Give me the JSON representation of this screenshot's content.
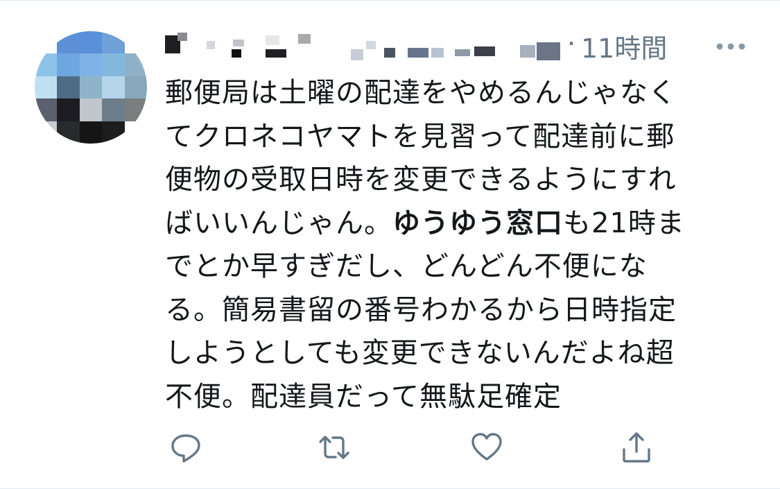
{
  "tweet": {
    "time": "11時間",
    "separator": "·",
    "body_lines": [
      {
        "parts": [
          {
            "text": "郵便局は土曜の配達をやめるんじゃなく",
            "bold": false
          }
        ]
      },
      {
        "parts": [
          {
            "text": "てクロネコヤマトを見習って配達前に郵",
            "bold": false
          }
        ]
      },
      {
        "parts": [
          {
            "text": "便物の受取日時を変更できるようにすれ",
            "bold": false
          }
        ]
      },
      {
        "parts": [
          {
            "text": "ばいいんじゃん。",
            "bold": false
          },
          {
            "text": "ゆうゆう窓口",
            "bold": true
          },
          {
            "text": "も21時ま",
            "bold": false
          }
        ]
      },
      {
        "parts": [
          {
            "text": "でとか早すぎだし、どんどん不便にな",
            "bold": false
          }
        ]
      },
      {
        "parts": [
          {
            "text": "る。簡易書留の番号わかるから日時指定",
            "bold": false
          }
        ]
      },
      {
        "parts": [
          {
            "text": "しようとしても変更できないんだよね超",
            "bold": false
          }
        ]
      },
      {
        "parts": [
          {
            "text": "不便。配達員だって無駄足確定",
            "bold": false
          }
        ]
      }
    ]
  },
  "icons": {
    "more": "more-horizontal-icon",
    "reply": "reply-icon",
    "retweet": "retweet-icon",
    "like": "heart-icon",
    "share": "share-icon"
  },
  "colors": {
    "text": "#14171a",
    "secondary": "#657786",
    "divider": "#e1e8ed"
  }
}
